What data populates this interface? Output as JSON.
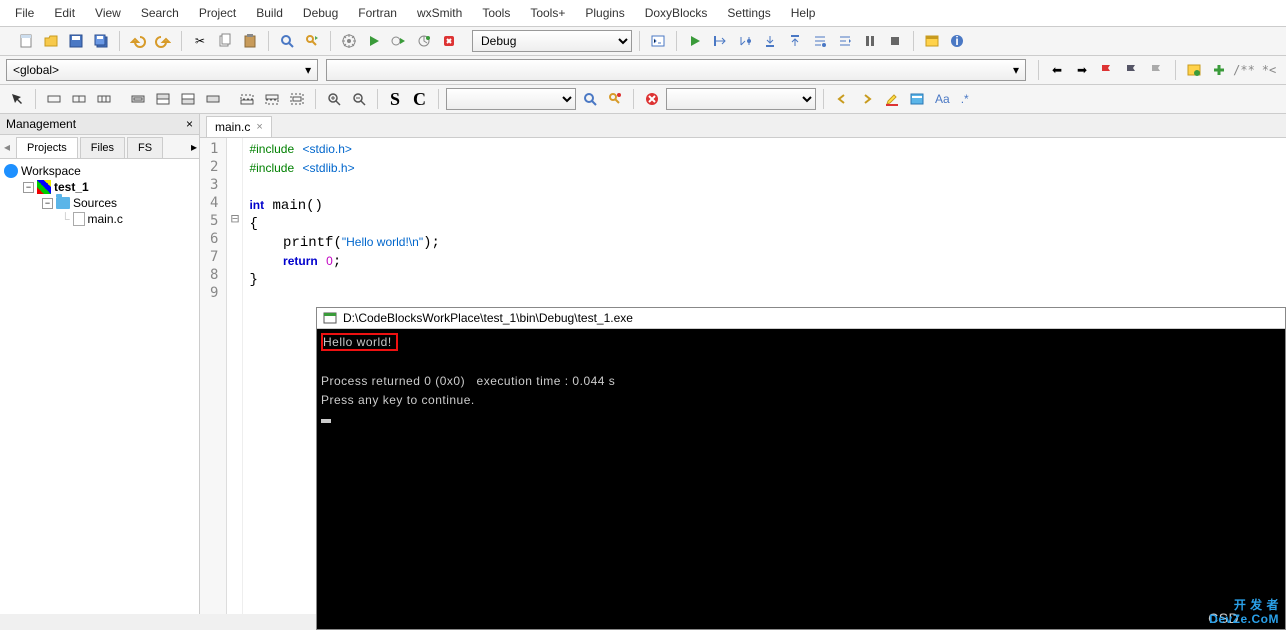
{
  "menu": [
    "File",
    "Edit",
    "View",
    "Search",
    "Project",
    "Build",
    "Debug",
    "Fortran",
    "wxSmith",
    "Tools",
    "Tools+",
    "Plugins",
    "DoxyBlocks",
    "Settings",
    "Help"
  ],
  "build_config": "Debug",
  "scope": {
    "left": "<global>",
    "right": ""
  },
  "management": {
    "title": "Management",
    "tabs": [
      "Projects",
      "Files",
      "FS"
    ],
    "workspace": "Workspace",
    "project": "test_1",
    "folder": "Sources",
    "file": "main.c"
  },
  "editor": {
    "tab": "main.c",
    "lines": [
      {
        "n": 1,
        "tokens": [
          [
            "pp",
            "#include"
          ],
          [
            "",
            " "
          ],
          [
            "str",
            "<stdio.h>"
          ]
        ]
      },
      {
        "n": 2,
        "tokens": [
          [
            "pp",
            "#include"
          ],
          [
            "",
            " "
          ],
          [
            "str",
            "<stdlib.h>"
          ]
        ]
      },
      {
        "n": 3,
        "tokens": []
      },
      {
        "n": 4,
        "tokens": [
          [
            "kw",
            "int"
          ],
          [
            "",
            " main"
          ],
          [
            "",
            "()"
          ]
        ]
      },
      {
        "n": 5,
        "fold": "⊟",
        "tokens": [
          [
            "",
            "{"
          ]
        ]
      },
      {
        "n": 6,
        "tokens": [
          [
            "",
            "    printf("
          ],
          [
            "str",
            "\"Hello world!\\n\""
          ],
          [
            "",
            ");"
          ]
        ]
      },
      {
        "n": 7,
        "tokens": [
          [
            "",
            "    "
          ],
          [
            "kw",
            "return"
          ],
          [
            "",
            " "
          ],
          [
            "num",
            "0"
          ],
          [
            "",
            ";"
          ]
        ]
      },
      {
        "n": 8,
        "tokens": [
          [
            "",
            "}"
          ]
        ]
      },
      {
        "n": 9,
        "tokens": []
      }
    ]
  },
  "console": {
    "title": "D:\\CodeBlocksWorkPlace\\test_1\\bin\\Debug\\test_1.exe",
    "hello": "Hello world!",
    "line2": "Process returned 0 (0x0)   execution time : 0.044 s",
    "line3": "Press any key to continue."
  },
  "watermark": {
    "top": "开 发 者",
    "mid": "DevZe.CoM",
    "csd": "CSD"
  }
}
